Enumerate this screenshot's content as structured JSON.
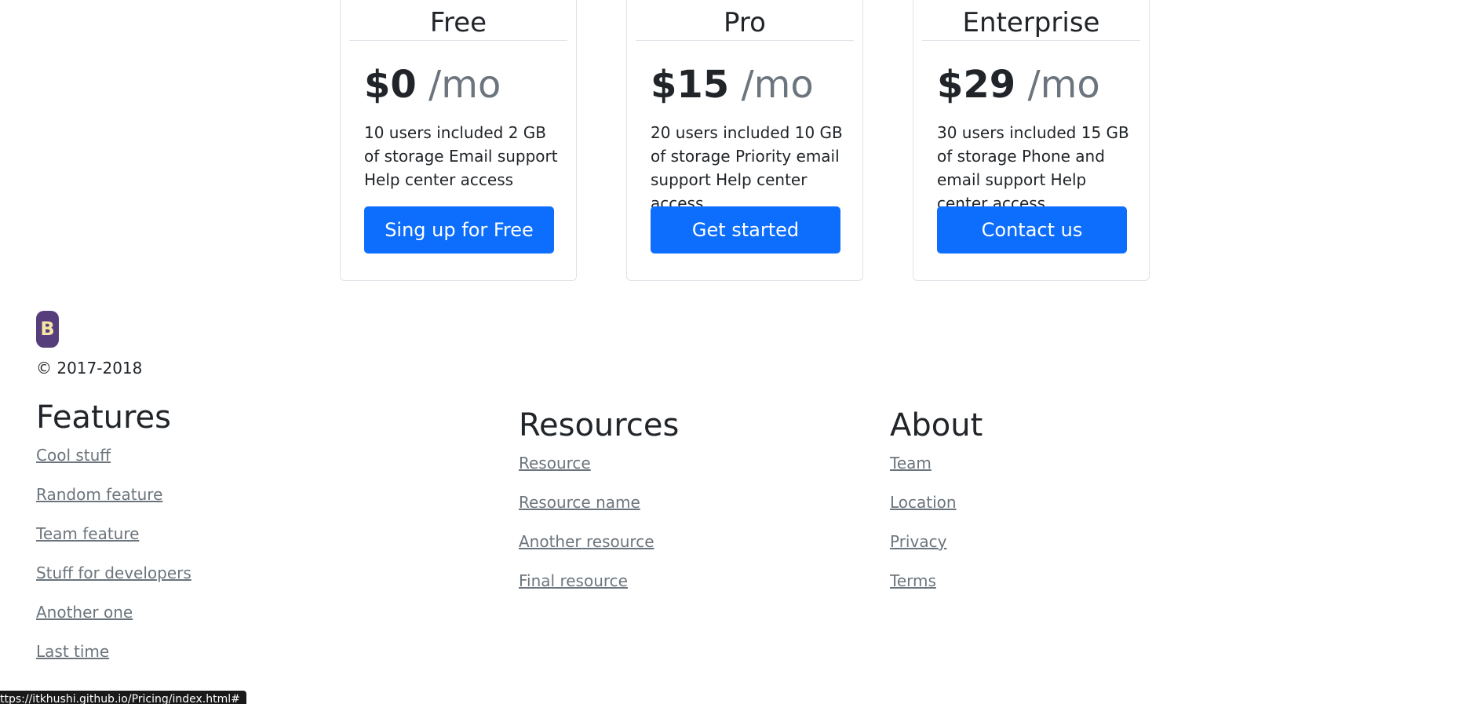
{
  "pricing": {
    "plans": [
      {
        "name": "Free",
        "price": "$0",
        "per": " /mo",
        "description": "10 users included 2 GB of storage Email support Help center access",
        "button": "Sing up for Free"
      },
      {
        "name": "Pro",
        "price": "$15",
        "per": " /mo",
        "description": "20 users included 10 GB of storage Priority email support Help center access",
        "button": "Get started"
      },
      {
        "name": "Enterprise",
        "price": "$29",
        "per": " /mo",
        "description": "30 users included 15 GB of storage Phone and email support Help center access",
        "button": "Contact us"
      }
    ]
  },
  "footer": {
    "logo_letter": "B",
    "copyright": "© 2017-2018",
    "columns": [
      {
        "title": "Features",
        "links": [
          "Cool stuff",
          "Random feature",
          "Team feature",
          "Stuff for developers",
          "Another one",
          "Last time"
        ]
      },
      {
        "title": "Resources",
        "links": [
          "Resource",
          "Resource name",
          "Another resource",
          "Final resource"
        ]
      },
      {
        "title": "About",
        "links": [
          "Team",
          "Location",
          "Privacy",
          "Terms"
        ]
      }
    ]
  },
  "status_bar": {
    "url": "ttps://itkhushi.github.io/Pricing/index.html#"
  },
  "colors": {
    "primary": "#0d6efd",
    "muted": "#6c757d",
    "brand": "#563d7c"
  }
}
